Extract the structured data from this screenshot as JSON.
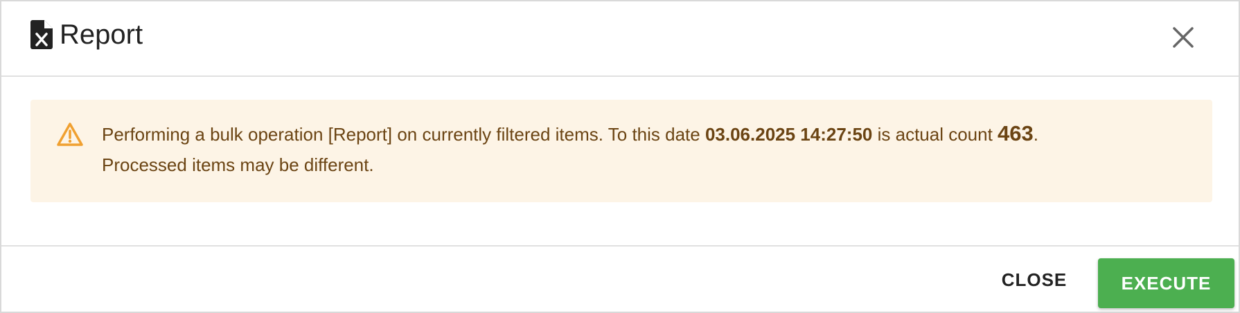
{
  "dialog": {
    "title": "Report",
    "title_icon": "excel-file-icon",
    "close_icon": "close-icon"
  },
  "alert": {
    "icon": "warning-triangle-icon",
    "text_part1": "Performing a bulk operation [Report] on currently filtered items. To this date ",
    "date": "03.06.2025 14:27:50",
    "text_part2": " is actual count ",
    "count": "463",
    "text_part3": ".",
    "text_line2": "Processed items may be different.",
    "colors": {
      "background": "#fdf4e6",
      "text": "#6b4413",
      "icon": "#f0a030"
    }
  },
  "footer": {
    "close_label": "CLOSE",
    "execute_label": "EXECUTE",
    "execute_color": "#4caf50"
  }
}
